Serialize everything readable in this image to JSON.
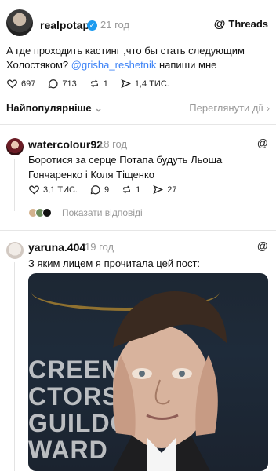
{
  "header": {
    "username": "realpotap",
    "time": "21 год",
    "brand": "Threads"
  },
  "post": {
    "text_before": "А где проходить кастинг ,что бы стать следующим Холостяком? ",
    "mention": "@grisha_reshetnik",
    "text_after": " напиши мне",
    "likes": "697",
    "comments": "713",
    "reposts": "1",
    "shares": "1,4 ТИС."
  },
  "sort": {
    "label": "Найпопулярніше",
    "view_activity": "Переглянути дії"
  },
  "comments": [
    {
      "username": "watercolour92",
      "time": "18 год",
      "text": "Боротися за серце Потапа будуть Льоша Гончаренко і Коля Тіщенко",
      "likes": "3,1 ТИС.",
      "comments": "9",
      "reposts": "1",
      "shares": "27",
      "show_replies": "Показати відповіді"
    },
    {
      "username": "yaruna.404",
      "time": "19 год",
      "text": "З яким лицем я прочитала цей пост:",
      "image_text": [
        "CREEN",
        "CTORS",
        "GUILDO",
        "WARD"
      ]
    }
  ],
  "colors": {
    "accent": "#3b82f6",
    "muted": "#9a9a9a",
    "verified": "#1d9bf0"
  }
}
